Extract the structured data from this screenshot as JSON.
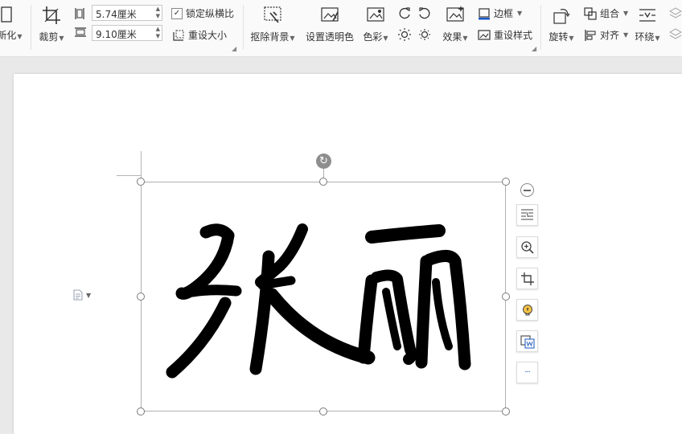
{
  "ribbon": {
    "partial_left_label": "新化",
    "crop_label": "裁剪",
    "height_value": "5.74厘米",
    "width_value": "9.10厘米",
    "lock_ratio_label": "锁定纵横比",
    "lock_ratio_checked": true,
    "reset_size_label": "重设大小",
    "remove_bg_label": "抠除背景",
    "set_transparent_label": "设置透明色",
    "color_label": "色彩",
    "effects_label": "效果",
    "border_label": "边框",
    "reset_style_label": "重设样式",
    "rotate_label": "旋转",
    "group_label": "组合",
    "align_label": "对齐",
    "wrap_label": "环绕"
  },
  "image": {
    "content_text": "张丽"
  },
  "side_toolbar": {
    "items": [
      "collapse",
      "layout-options",
      "zoom-in",
      "crop",
      "smart-suggest",
      "image-to-word",
      "more"
    ],
    "more_label": "···"
  }
}
